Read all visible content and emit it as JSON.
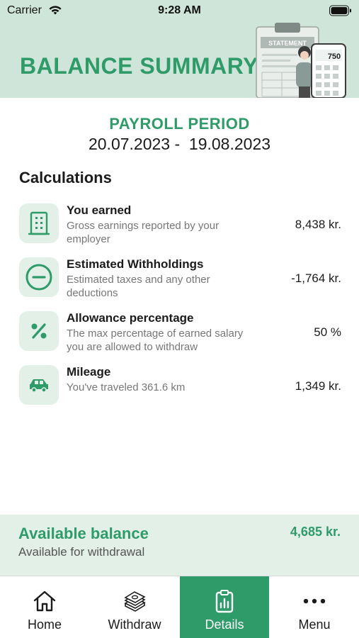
{
  "status_bar": {
    "carrier": "Carrier",
    "time": "9:28 AM"
  },
  "header": {
    "title": "BALANCE SUMMARY",
    "illustration": {
      "sheet_label": "STATEMENT",
      "phone_value": "750"
    }
  },
  "payroll": {
    "title": "PAYROLL PERIOD",
    "range": "20.07.2023 -  19.08.2023"
  },
  "calculations": {
    "title": "Calculations",
    "items": [
      {
        "icon": "building-icon",
        "title": "You earned",
        "line1": "Gross earnings reported by your",
        "line2": "employer",
        "value": "8,438 kr."
      },
      {
        "icon": "minus-circle-icon",
        "title": "Estimated Withholdings",
        "line1": "Estimated taxes and any other",
        "line2": "deductions",
        "value": "-1,764 kr."
      },
      {
        "icon": "percent-icon",
        "title": "Allowance percentage",
        "line1": "The max percentage of earned salary",
        "line2": "you are allowed to withdraw",
        "value": "50 %"
      },
      {
        "icon": "car-icon",
        "title": "Mileage",
        "line1": "You've traveled 361.6 km",
        "line2": "",
        "value": "1,349 kr."
      }
    ]
  },
  "balance": {
    "title": "Available balance",
    "subtitle": "Available for withdrawal",
    "value": "4,685 kr."
  },
  "tabs": [
    {
      "label": "Home",
      "icon": "home-icon",
      "active": false
    },
    {
      "label": "Withdraw",
      "icon": "cash-stack-icon",
      "active": false
    },
    {
      "label": "Details",
      "icon": "clipboard-chart-icon",
      "active": true
    },
    {
      "label": "Menu",
      "icon": "more-dots-icon",
      "active": false
    }
  ],
  "colors": {
    "accent": "#2f9b69",
    "header_bg": "#cfe5d9",
    "icon_tile_bg": "#e2f0e8",
    "balance_bg": "#e2f0e8"
  }
}
